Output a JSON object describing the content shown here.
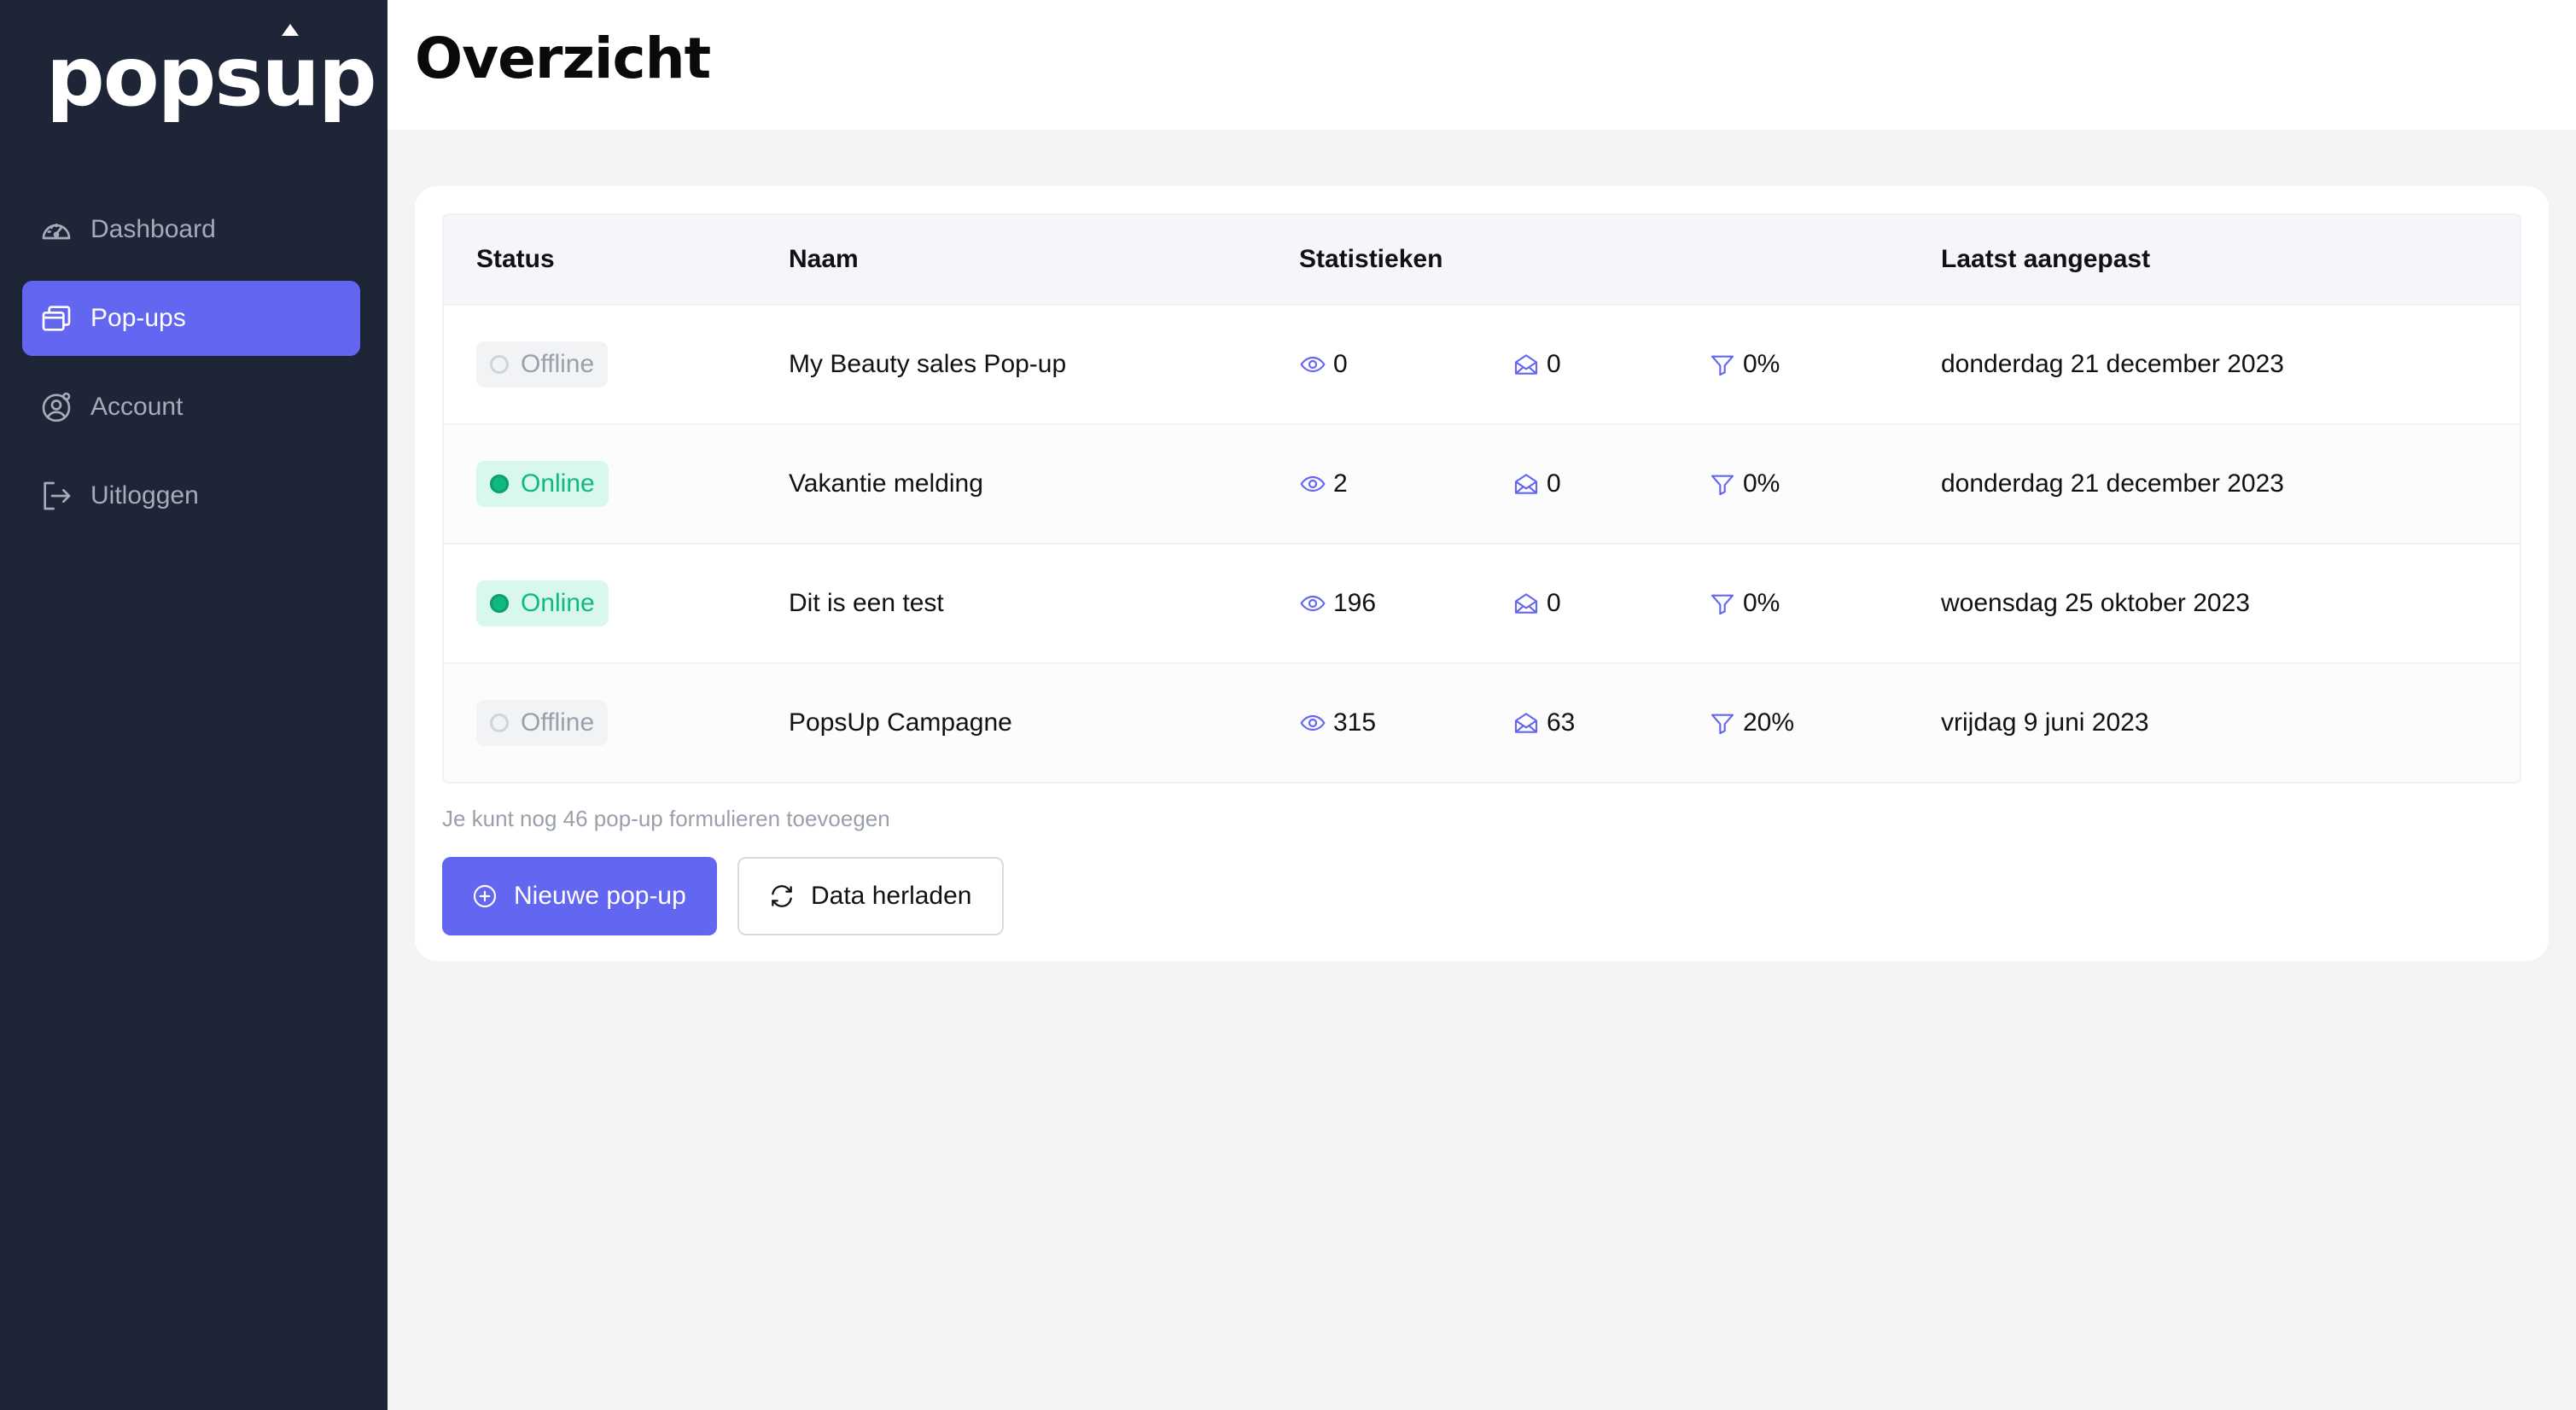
{
  "app": {
    "logo_text": "popsup"
  },
  "sidebar": {
    "items": [
      {
        "label": "Dashboard",
        "icon": "gauge-icon",
        "active": false
      },
      {
        "label": "Pop-ups",
        "icon": "windows-icon",
        "active": true
      },
      {
        "label": "Account",
        "icon": "user-gear-icon",
        "active": false
      },
      {
        "label": "Uitloggen",
        "icon": "logout-icon",
        "active": false
      }
    ]
  },
  "header": {
    "title": "Overzicht"
  },
  "table": {
    "columns": [
      "Status",
      "Naam",
      "Statistieken",
      "Laatst aangepast"
    ],
    "rows": [
      {
        "status": "Offline",
        "name": "My Beauty sales Pop-up",
        "views": "0",
        "submissions": "0",
        "conversion": "0%",
        "updated": "donderdag 21 december 2023"
      },
      {
        "status": "Online",
        "name": "Vakantie melding",
        "views": "2",
        "submissions": "0",
        "conversion": "0%",
        "updated": "donderdag 21 december 2023"
      },
      {
        "status": "Online",
        "name": "Dit is een test",
        "views": "196",
        "submissions": "0",
        "conversion": "0%",
        "updated": "woensdag 25 oktober 2023"
      },
      {
        "status": "Offline",
        "name": "PopsUp Campagne",
        "views": "315",
        "submissions": "63",
        "conversion": "20%",
        "updated": "vrijdag 9 juni 2023"
      }
    ]
  },
  "footer": {
    "hint": "Je kunt nog 46 pop-up formulieren toevoegen",
    "new_button": "Nieuwe pop-up",
    "reload_button": "Data herladen"
  },
  "colors": {
    "sidebar_bg": "#1e2537",
    "accent": "#6366f1",
    "online": "#10b981",
    "offline": "#9aa0ab"
  }
}
